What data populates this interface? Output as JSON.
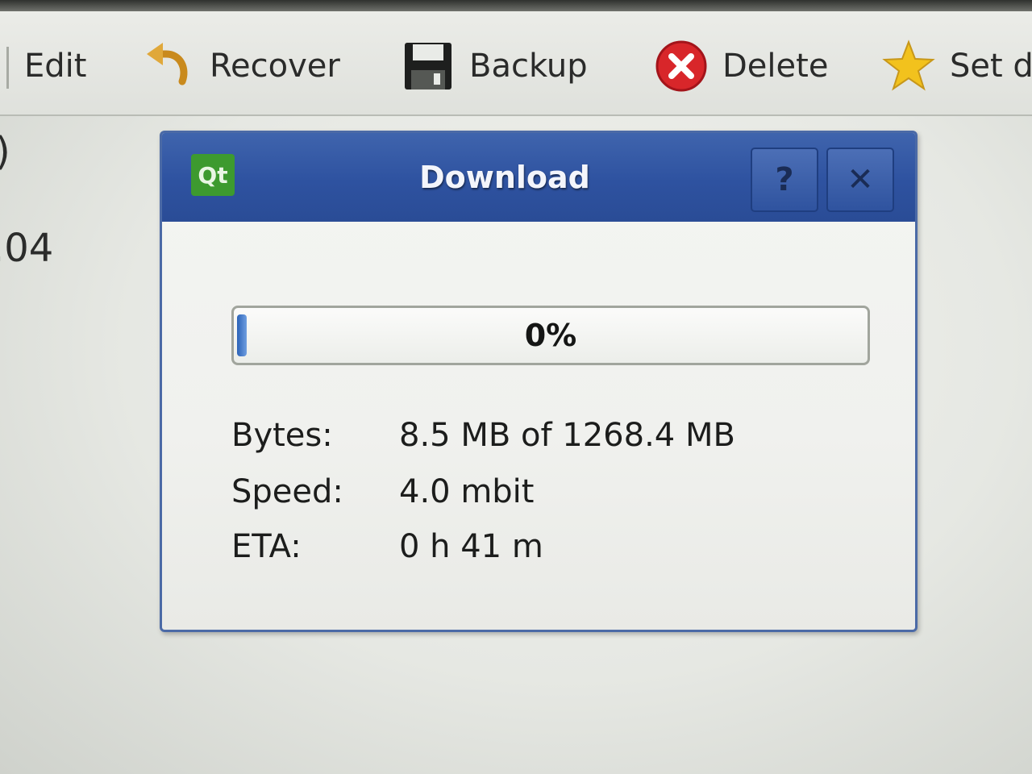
{
  "toolbar": {
    "edit_label": "Edit",
    "recover_label": "Recover",
    "backup_label": "Backup",
    "delete_label": "Delete",
    "set_label": "Set d"
  },
  "background": {
    "line1": ")",
    "line2": ".04"
  },
  "dialog": {
    "logo_text": "Qt",
    "title": "Download",
    "help_label": "?",
    "close_label": "✕",
    "progress_value": 0,
    "progress_text": "0%",
    "rows": [
      {
        "label": "Bytes:",
        "value": "8.5 MB of 1268.4 MB"
      },
      {
        "label": "Speed:",
        "value": "4.0 mbit"
      },
      {
        "label": "ETA:",
        "value": "0 h 41 m"
      }
    ]
  },
  "colors": {
    "titlebar": "#2e52a0",
    "qt_green": "#3d9a2f",
    "delete_red": "#d8262a",
    "star_yellow": "#f2c21d"
  }
}
